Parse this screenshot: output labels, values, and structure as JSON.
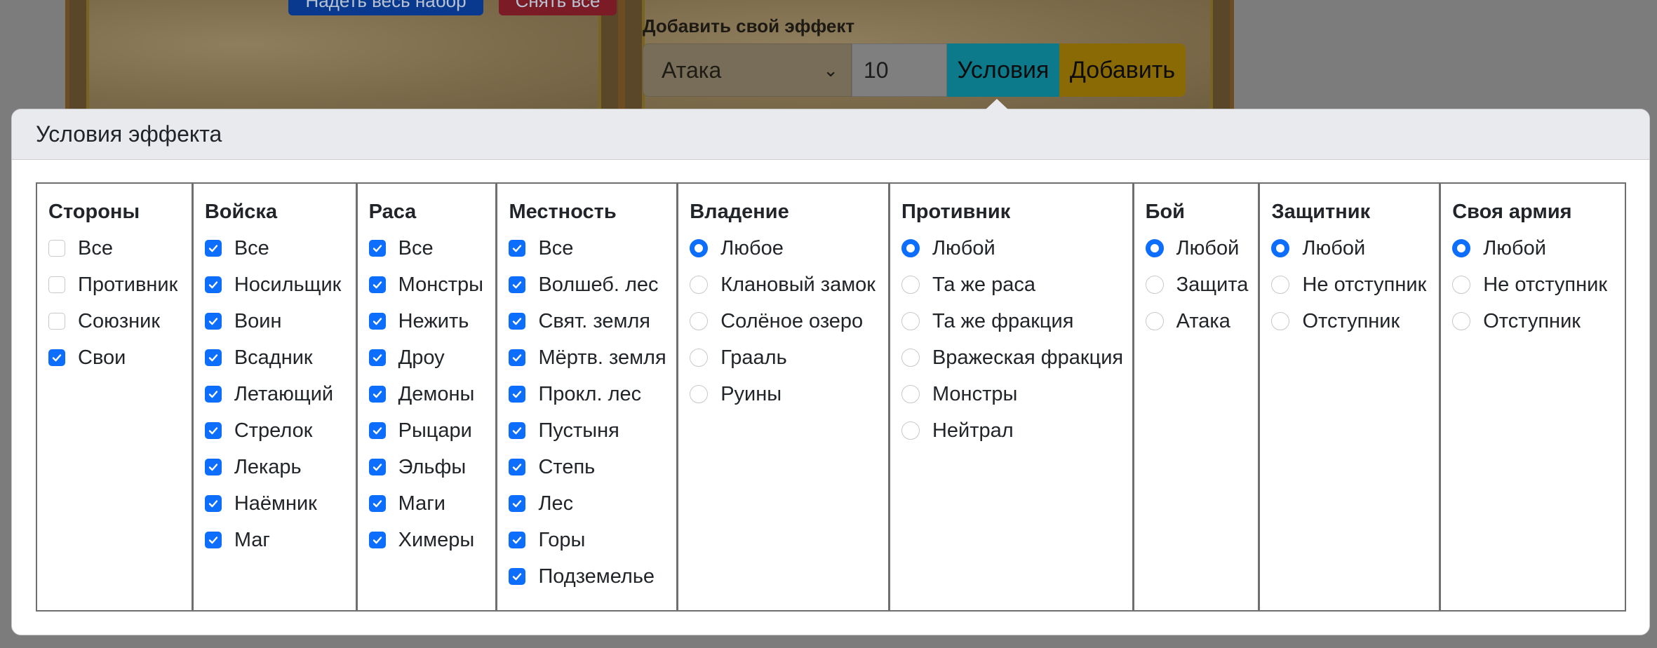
{
  "background": {
    "set_button_label": "Надеть весь набор",
    "remove_button_label": "Снять все",
    "effect_label": "Добавить свой эффект",
    "effect_select_value": "Атака",
    "effect_value": "10",
    "conditions_button_label": "Условия",
    "add_button_label": "Добавить"
  },
  "popover": {
    "title": "Условия эффекта",
    "columns": [
      {
        "title": "Стороны",
        "kind": "checkbox",
        "options": [
          {
            "label": "Все",
            "checked": false
          },
          {
            "label": "Противник",
            "checked": false
          },
          {
            "label": "Союзник",
            "checked": false
          },
          {
            "label": "Свои",
            "checked": true
          }
        ]
      },
      {
        "title": "Войска",
        "kind": "checkbox",
        "options": [
          {
            "label": "Все",
            "checked": true
          },
          {
            "label": "Носильщик",
            "checked": true
          },
          {
            "label": "Воин",
            "checked": true
          },
          {
            "label": "Всадник",
            "checked": true
          },
          {
            "label": "Летающий",
            "checked": true
          },
          {
            "label": "Стрелок",
            "checked": true
          },
          {
            "label": "Лекарь",
            "checked": true
          },
          {
            "label": "Наёмник",
            "checked": true
          },
          {
            "label": "Маг",
            "checked": true
          }
        ]
      },
      {
        "title": "Раса",
        "kind": "checkbox",
        "options": [
          {
            "label": "Все",
            "checked": true
          },
          {
            "label": "Монстры",
            "checked": true
          },
          {
            "label": "Нежить",
            "checked": true
          },
          {
            "label": "Дроу",
            "checked": true
          },
          {
            "label": "Демоны",
            "checked": true
          },
          {
            "label": "Рыцари",
            "checked": true
          },
          {
            "label": "Эльфы",
            "checked": true
          },
          {
            "label": "Маги",
            "checked": true
          },
          {
            "label": "Химеры",
            "checked": true
          }
        ]
      },
      {
        "title": "Местность",
        "kind": "checkbox",
        "options": [
          {
            "label": "Все",
            "checked": true
          },
          {
            "label": "Волшеб. лес",
            "checked": true
          },
          {
            "label": "Свят. земля",
            "checked": true
          },
          {
            "label": "Мёртв. земля",
            "checked": true
          },
          {
            "label": "Прокл. лес",
            "checked": true
          },
          {
            "label": "Пустыня",
            "checked": true
          },
          {
            "label": "Степь",
            "checked": true
          },
          {
            "label": "Лес",
            "checked": true
          },
          {
            "label": "Горы",
            "checked": true
          },
          {
            "label": "Подземелье",
            "checked": true
          }
        ]
      },
      {
        "title": "Владение",
        "kind": "radio",
        "options": [
          {
            "label": "Любое",
            "checked": true
          },
          {
            "label": "Клановый замок",
            "checked": false
          },
          {
            "label": "Солёное озеро",
            "checked": false
          },
          {
            "label": "Грааль",
            "checked": false
          },
          {
            "label": "Руины",
            "checked": false
          }
        ]
      },
      {
        "title": "Противник",
        "kind": "radio",
        "options": [
          {
            "label": "Любой",
            "checked": true
          },
          {
            "label": "Та же раса",
            "checked": false
          },
          {
            "label": "Та же фракция",
            "checked": false
          },
          {
            "label": "Вражеская фракция",
            "checked": false
          },
          {
            "label": "Монстры",
            "checked": false
          },
          {
            "label": "Нейтрал",
            "checked": false
          }
        ]
      },
      {
        "title": "Бой",
        "kind": "radio",
        "options": [
          {
            "label": "Любой",
            "checked": true
          },
          {
            "label": "Защита",
            "checked": false
          },
          {
            "label": "Атака",
            "checked": false
          }
        ]
      },
      {
        "title": "Защитник",
        "kind": "radio",
        "options": [
          {
            "label": "Любой",
            "checked": true
          },
          {
            "label": "Не отступник",
            "checked": false
          },
          {
            "label": "Отступник",
            "checked": false
          }
        ]
      },
      {
        "title": "Своя армия",
        "kind": "radio",
        "options": [
          {
            "label": "Любой",
            "checked": true
          },
          {
            "label": "Не отступник",
            "checked": false
          },
          {
            "label": "Отступник",
            "checked": false
          }
        ]
      }
    ]
  },
  "colors": {
    "accent": "#0d6efd",
    "conditions_button": "#0dcaf0",
    "add_button": "#ffc107",
    "overlay": "#7c7c7c"
  }
}
